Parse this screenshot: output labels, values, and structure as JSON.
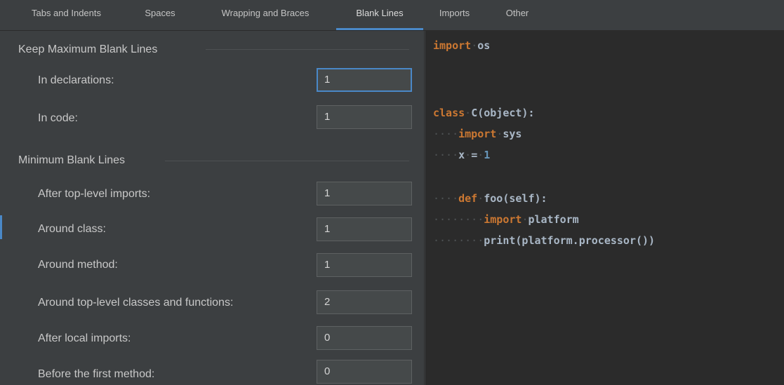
{
  "tabs": [
    {
      "label": "Tabs and Indents",
      "active": false
    },
    {
      "label": "Spaces",
      "active": false
    },
    {
      "label": "Wrapping and Braces",
      "active": false
    },
    {
      "label": "Blank Lines",
      "active": true
    },
    {
      "label": "Imports",
      "active": false
    },
    {
      "label": "Other",
      "active": false
    }
  ],
  "keep_max": {
    "title": "Keep Maximum Blank Lines",
    "rows": [
      {
        "label": "In declarations:",
        "value": "1"
      },
      {
        "label": "In code:",
        "value": "1"
      }
    ]
  },
  "minimum": {
    "title": "Minimum Blank Lines",
    "rows": [
      {
        "label": "After top-level imports:",
        "value": "1"
      },
      {
        "label": "Around class:",
        "value": "1"
      },
      {
        "label": "Around method:",
        "value": "1"
      },
      {
        "label": "Around top-level classes and functions:",
        "value": "2"
      },
      {
        "label": "After local imports:",
        "value": "0"
      },
      {
        "label": "Before the first method:",
        "value": "0"
      }
    ]
  },
  "code_preview": {
    "lines": [
      [
        {
          "t": "kw",
          "s": "import"
        },
        {
          "t": "ws",
          "s": "·"
        },
        {
          "t": "tx",
          "s": "os"
        }
      ],
      [],
      [],
      [
        {
          "t": "kw",
          "s": "class"
        },
        {
          "t": "ws",
          "s": "·"
        },
        {
          "t": "tx",
          "s": "C(object):"
        }
      ],
      [
        {
          "t": "ws",
          "s": "····"
        },
        {
          "t": "kw",
          "s": "import"
        },
        {
          "t": "ws",
          "s": "·"
        },
        {
          "t": "tx",
          "s": "sys"
        }
      ],
      [
        {
          "t": "ws",
          "s": "····"
        },
        {
          "t": "tx",
          "s": "x"
        },
        {
          "t": "ws",
          "s": "·"
        },
        {
          "t": "tx",
          "s": "="
        },
        {
          "t": "ws",
          "s": "·"
        },
        {
          "t": "num",
          "s": "1"
        }
      ],
      [],
      [
        {
          "t": "ws",
          "s": "····"
        },
        {
          "t": "kw",
          "s": "def"
        },
        {
          "t": "ws",
          "s": "·"
        },
        {
          "t": "tx",
          "s": "foo(self):"
        }
      ],
      [
        {
          "t": "ws",
          "s": "········"
        },
        {
          "t": "kw",
          "s": "import"
        },
        {
          "t": "ws",
          "s": "·"
        },
        {
          "t": "tx",
          "s": "platform"
        }
      ],
      [
        {
          "t": "ws",
          "s": "········"
        },
        {
          "t": "tx",
          "s": "print(platform.processor())"
        }
      ]
    ]
  },
  "colors": {
    "accent": "#4a88c7",
    "keyword": "#cc7832",
    "number": "#6897bb",
    "text": "#a9b7c6",
    "panel_bg": "#3c3f41",
    "editor_bg": "#2b2b2b"
  }
}
